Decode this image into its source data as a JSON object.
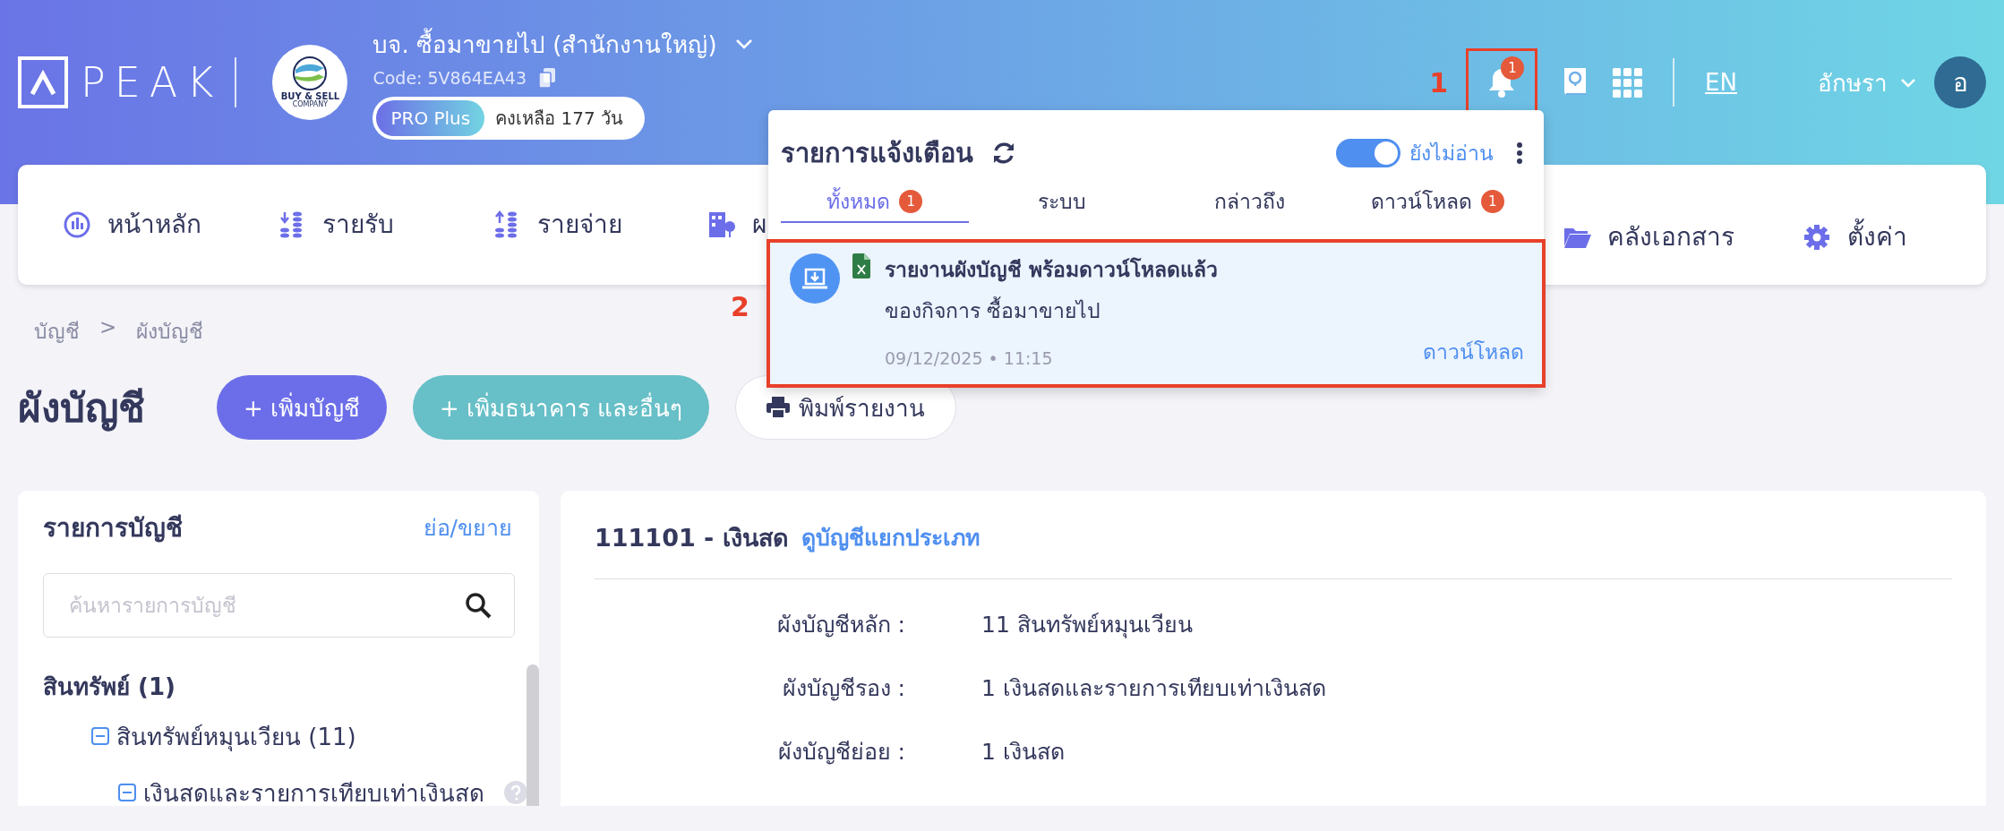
{
  "header": {
    "logo_text": "PEAK",
    "company_logo_text": [
      "BUY & SELL",
      "COMPANY"
    ],
    "company_name": "บจ. ซื้อมาขายไป (สำนักงานใหญ่)",
    "company_code": "Code: 5V864EA43",
    "plan": "PRO Plus",
    "days_left": "คงเหลือ 177 วัน",
    "bell": {
      "count": "1",
      "highlighted": true,
      "marker": "1"
    },
    "language": "EN",
    "user_name": "อักษรา",
    "avatar_initial": "อ"
  },
  "nav": [
    {
      "kind": "dashboard",
      "label": "หน้าหลัก"
    },
    {
      "kind": "income",
      "label": "รายรับ"
    },
    {
      "kind": "expense",
      "label": "รายจ่าย"
    },
    {
      "kind": "building",
      "label": "ผ"
    },
    {
      "kind": "folder",
      "label": "คลังเอกสาร"
    },
    {
      "kind": "gear",
      "label": "ตั้งค่า"
    }
  ],
  "notifications": {
    "title": "รายการแจ้งเตือน",
    "unread_filter": {
      "label": "ยังไม่อ่าน",
      "on": true
    },
    "tabs": [
      {
        "label": "ทั้งหมด",
        "count": "1",
        "selected": true
      },
      {
        "label": "ระบบ",
        "selected": false
      },
      {
        "label": "กล่าวถึง",
        "selected": false
      },
      {
        "label": "ดาวน์โหลด",
        "count": "1",
        "selected": false
      }
    ],
    "items": [
      {
        "title": "รายงานผังบัญชี พร้อมดาวน์โหลดแล้ว",
        "subtitle": "ของกิจการ ซื้อมาขายไป",
        "time": "09/12/2025 • 11:15",
        "action": "ดาวน์โหลด",
        "highlighted": true,
        "marker": "2"
      }
    ]
  },
  "breadcrumb": {
    "items": [
      "บัญชี",
      "ผังบัญชี"
    ],
    "separator": ">"
  },
  "page_title": "ผังบัญชี",
  "actions": [
    {
      "kind": "primary",
      "label": "+ เพิ่มบัญชี"
    },
    {
      "kind": "secondary",
      "label": "+ เพิ่มธนาคาร และอื่นๆ"
    },
    {
      "kind": "print",
      "label": "พิมพ์รายงาน"
    }
  ],
  "account_list": {
    "title": "รายการบัญชี",
    "toggle": "ย่อ/ขยาย",
    "search_placeholder": "ค้นหารายการบัญชี",
    "tree": [
      {
        "label": "สินทรัพย์ (1)",
        "children": [
          {
            "label": "สินทรัพย์หมุนเวียน (11)",
            "expanded": true,
            "children": [
              {
                "label": "เงินสดและรายการเทียบเท่าเงินสด",
                "expanded": true,
                "help": true
              }
            ]
          }
        ]
      }
    ]
  },
  "detail": {
    "title": "111101 - เงินสด",
    "link": "ดูบัญชีแยกประเภท",
    "fields": [
      {
        "label": "ผังบัญชีหลัก :",
        "value": "11 สินทรัพย์หมุนเวียน"
      },
      {
        "label": "ผังบัญชีรอง :",
        "value": "1 เงินสดและรายการเทียบเท่าเงินสด"
      },
      {
        "label": "ผังบัญชีย่อย :",
        "value": "1 เงินสด"
      }
    ]
  }
}
